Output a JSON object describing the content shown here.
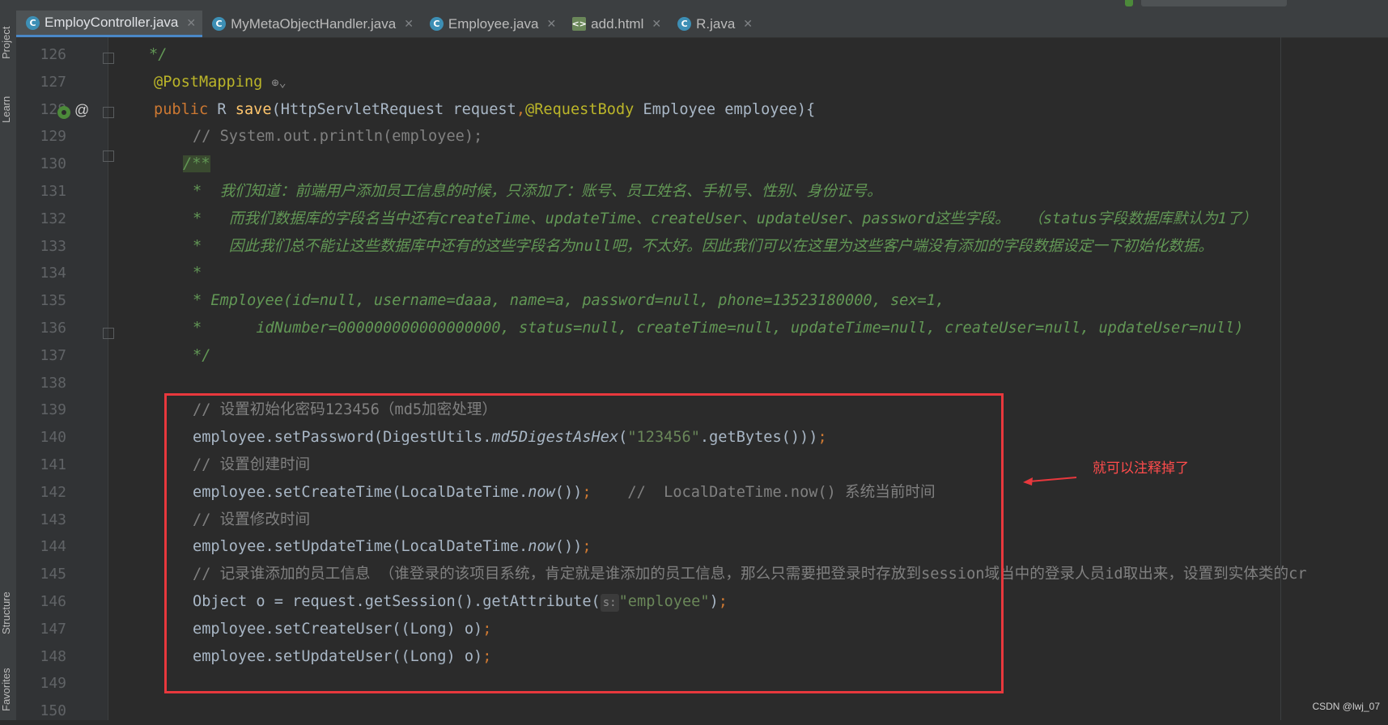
{
  "tabs": [
    {
      "label": "EmployController.java",
      "icon": "class-icon",
      "active": true
    },
    {
      "label": "MyMetaObjectHandler.java",
      "icon": "class-icon",
      "active": false
    },
    {
      "label": "Employee.java",
      "icon": "class-icon",
      "active": false
    },
    {
      "label": "add.html",
      "icon": "html-file-icon",
      "active": false
    },
    {
      "label": "R.java",
      "icon": "class-icon",
      "active": false
    }
  ],
  "side_labels": {
    "project": "Project",
    "learn": "Learn",
    "structure": "Structure",
    "favorites": "Favorites"
  },
  "line_numbers": [
    "126",
    "127",
    "128",
    "129",
    "130",
    "131",
    "132",
    "133",
    "134",
    "135",
    "136",
    "137",
    "138",
    "139",
    "140",
    "141",
    "142",
    "143",
    "144",
    "145",
    "146",
    "147",
    "148",
    "149",
    "150"
  ],
  "code": {
    "l126": "*/",
    "l127_ann": "@PostMapping",
    "l128_public": "public",
    "l128_rtype": "R",
    "l128_method": "save",
    "l128_paren": "(HttpServletRequest request",
    "l128_comma": ",",
    "l128_ann": "@RequestBody",
    "l128_rest": " Employee employee){",
    "l129": "// System.out.println(employee);",
    "l130": "/**",
    "l131": "*  我们知道：前端用户添加员工信息的时候，只添加了：账号、员工姓名、手机号、性别、身份证号。",
    "l132": "*   而我们数据库的字段名当中还有createTime、updateTime、createUser、updateUser、password这些字段。  （status字段数据库默认为1了）",
    "l133": "*   因此我们总不能让这些数据库中还有的这些字段名为null吧，不太好。因此我们可以在这里为这些客户端没有添加的字段数据设定一下初始化数据。",
    "l134": "*",
    "l135": "* Employee(id=null, username=daaa, name=a, password=null, phone=13523180000, sex=1,",
    "l136": "*      idNumber=000000000000000000, status=null, createTime=null, updateTime=null, createUser=null, updateUser=null)",
    "l137": "*/",
    "l139": "// 设置初始化密码123456（md5加密处理）",
    "l140_a": "employee.setPassword(DigestUtils.",
    "l140_b": "md5DigestAsHex",
    "l140_c": "(",
    "l140_str": "\"123456\"",
    "l140_d": ".getBytes()))",
    "l140_semi": ";",
    "l141": "// 设置创建时间",
    "l142_a": "employee.setCreateTime(LocalDateTime.",
    "l142_b": "now",
    "l142_c": "())",
    "l142_semi": ";",
    "l142_cm": "    //  LocalDateTime.now() 系统当前时间",
    "l143": "// 设置修改时间",
    "l144_a": "employee.setUpdateTime(LocalDateTime.",
    "l144_b": "now",
    "l144_c": "())",
    "l144_semi": ";",
    "l145": "// 记录谁添加的员工信息 （谁登录的该项目系统，肯定就是谁添加的员工信息，那么只需要把登录时存放到session域当中的登录人员id取出来，设置到实体类的cr",
    "l146_a": "Object o = request.getSession().getAttribute(",
    "l146_hint": "s:",
    "l146_str": "\"employee\"",
    "l146_b": ")",
    "l146_semi": ";",
    "l147_a": "employee.setCreateUser((Long) o)",
    "l147_semi": ";",
    "l148_a": "employee.setUpdateUser((Long) o)",
    "l148_semi": ";"
  },
  "annotation": {
    "note": "就可以注释掉了",
    "color": "#e8383d"
  },
  "watermark": "CSDN @lwj_07"
}
